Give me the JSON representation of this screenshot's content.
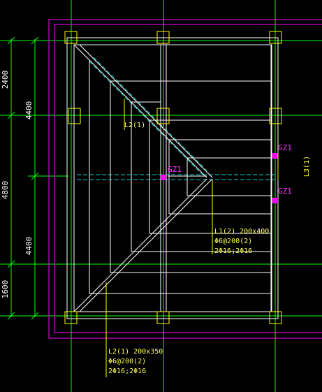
{
  "colors": {
    "background": "#000000",
    "grid_line": "#00ff00",
    "dimension_line": "#00ff00",
    "dimension_text": "#ffffff",
    "outline": "#ff00ff",
    "beam": "#ffffff",
    "column": "#ffff00",
    "hidden_beam": "#00cccc",
    "label": "#ffff55",
    "constructional_column": "#ff00ff"
  },
  "dimensions_left": {
    "outer": [
      "2400",
      "4800",
      "1600"
    ],
    "inner": [
      "4400",
      "4400"
    ]
  },
  "beam_labels": {
    "l2_short": "L2(1)",
    "l3": "L3(1)",
    "l1": {
      "line1": "L1(2) 200x400",
      "line2": "Φ6@200(2)",
      "line3": "2Φ16;2Φ16"
    },
    "l2_full": {
      "line1": "L2(1) 200x350",
      "line2": "Φ6@200(2)",
      "line3": "2Φ16;2Φ16"
    }
  },
  "gz_labels": [
    "GZ1",
    "GZ1",
    "GZ1"
  ]
}
